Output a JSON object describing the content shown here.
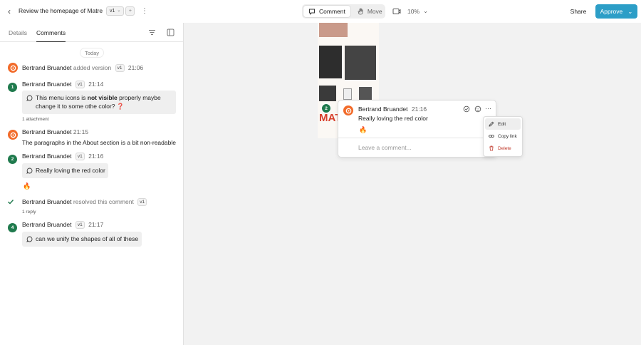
{
  "header": {
    "title": "Review the homepage of Matre",
    "version": "v1",
    "modes": {
      "comment": "Comment",
      "move": "Move"
    },
    "zoom": "10%",
    "share": "Share",
    "approve": "Approve"
  },
  "sidebar": {
    "tabs": {
      "details": "Details",
      "comments": "Comments"
    },
    "today": "Today",
    "activity": [
      {
        "author": "Bertrand Bruandet",
        "action": "added version",
        "version": "v1",
        "time": "21:06"
      },
      {
        "pin": "1",
        "author": "Bertrand Bruandet",
        "version": "v1",
        "time": "21:14",
        "text_pre": "This menu icons is ",
        "text_bold": "not visible",
        "text_mid": " properly maybe",
        "text_line2": "change it to some othe color?",
        "question": "❓",
        "attachment": "1 attachment"
      },
      {
        "author": "Bertrand Bruandet",
        "time": "21:15",
        "text": "The paragraphs in the About section is a bit non-readable"
      },
      {
        "pin": "2",
        "author": "Bertrand Bruandet",
        "version": "v1",
        "time": "21:16",
        "text": "Really loving the red color",
        "emoji": "🔥"
      },
      {
        "author": "Bertrand Bruandet",
        "action": "resolved this comment",
        "version": "v1",
        "reply": "1 reply"
      },
      {
        "pin": "4",
        "author": "Bertrand Bruandet",
        "version": "v1",
        "time": "21:17",
        "text": "can we unify the shapes of all of these"
      }
    ]
  },
  "canvas": {
    "mock_text": "MAT",
    "pin": "2",
    "popup": {
      "author": "Bertrand Bruandet",
      "time": "21:16",
      "text": "Really loving the red color",
      "emoji": "🔥",
      "reply_placeholder": "Leave a comment..."
    },
    "menu": {
      "edit": "Edit",
      "copy_link": "Copy link",
      "delete": "Delete"
    }
  },
  "colors": {
    "accent": "#2c9ec7",
    "pin": "#1f7a4d",
    "avatar": "#f26b2a",
    "danger": "#c0392b"
  }
}
